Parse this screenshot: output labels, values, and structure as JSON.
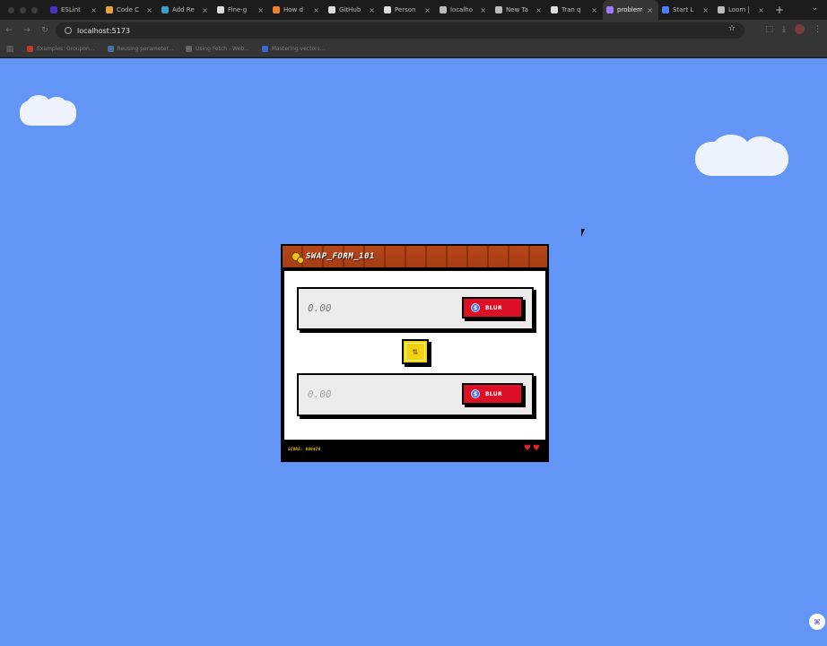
{
  "browser": {
    "tabs": [
      {
        "label": "ESLint",
        "icon": "eslint-icon",
        "color": "#4b32c3"
      },
      {
        "label": "Code C",
        "icon": "code-icon",
        "color": "#e8a23a"
      },
      {
        "label": "Add Re",
        "icon": "react-icon",
        "color": "#38a1c4"
      },
      {
        "label": "Fine-g",
        "icon": "github-icon",
        "color": "#dddddd"
      },
      {
        "label": "How d",
        "icon": "stackoverflow-icon",
        "color": "#f48024"
      },
      {
        "label": "GitHub",
        "icon": "github-icon",
        "color": "#dddddd"
      },
      {
        "label": "Person",
        "icon": "github-icon",
        "color": "#dddddd"
      },
      {
        "label": "localho",
        "icon": "globe-icon",
        "color": "#bbbbbb"
      },
      {
        "label": "New Ta",
        "icon": "globe-icon",
        "color": "#bbbbbb"
      },
      {
        "label": "Tran q",
        "icon": "github-icon",
        "color": "#dddddd"
      },
      {
        "label": "problem",
        "icon": "gem-icon",
        "color": "#9b7bff",
        "active": true
      },
      {
        "label": "Start L",
        "icon": "loom-icon",
        "color": "#4f7bff"
      },
      {
        "label": "Loom |",
        "icon": "globe-icon",
        "color": "#bbbbbb"
      }
    ],
    "url": "localhost:5173",
    "bookmarks": [
      {
        "label": "Examples: Groupon...",
        "color": "#c0392b"
      },
      {
        "label": "Reusing parameter...",
        "color": "#4a6fa5"
      },
      {
        "label": "Using Fetch - Web...",
        "color": "#666666"
      },
      {
        "label": "Mastering vectors...",
        "color": "#3b6ad1"
      }
    ]
  },
  "swap": {
    "title": "SWAP_FORM_101",
    "from": {
      "amount": "0.00",
      "token": "BLUR",
      "token_symbol": "$"
    },
    "to": {
      "amount": "0.00",
      "token": "BLUR",
      "token_symbol": "$"
    },
    "swap_glyph": "⇅",
    "score": "SCORE: 000420",
    "lives": 2
  },
  "colors": {
    "sky": "#6295f5",
    "brick": "#b5461a",
    "token_button": "#dd0f27",
    "swap_button": "#f2d20d",
    "score_text": "#f5d10a"
  }
}
